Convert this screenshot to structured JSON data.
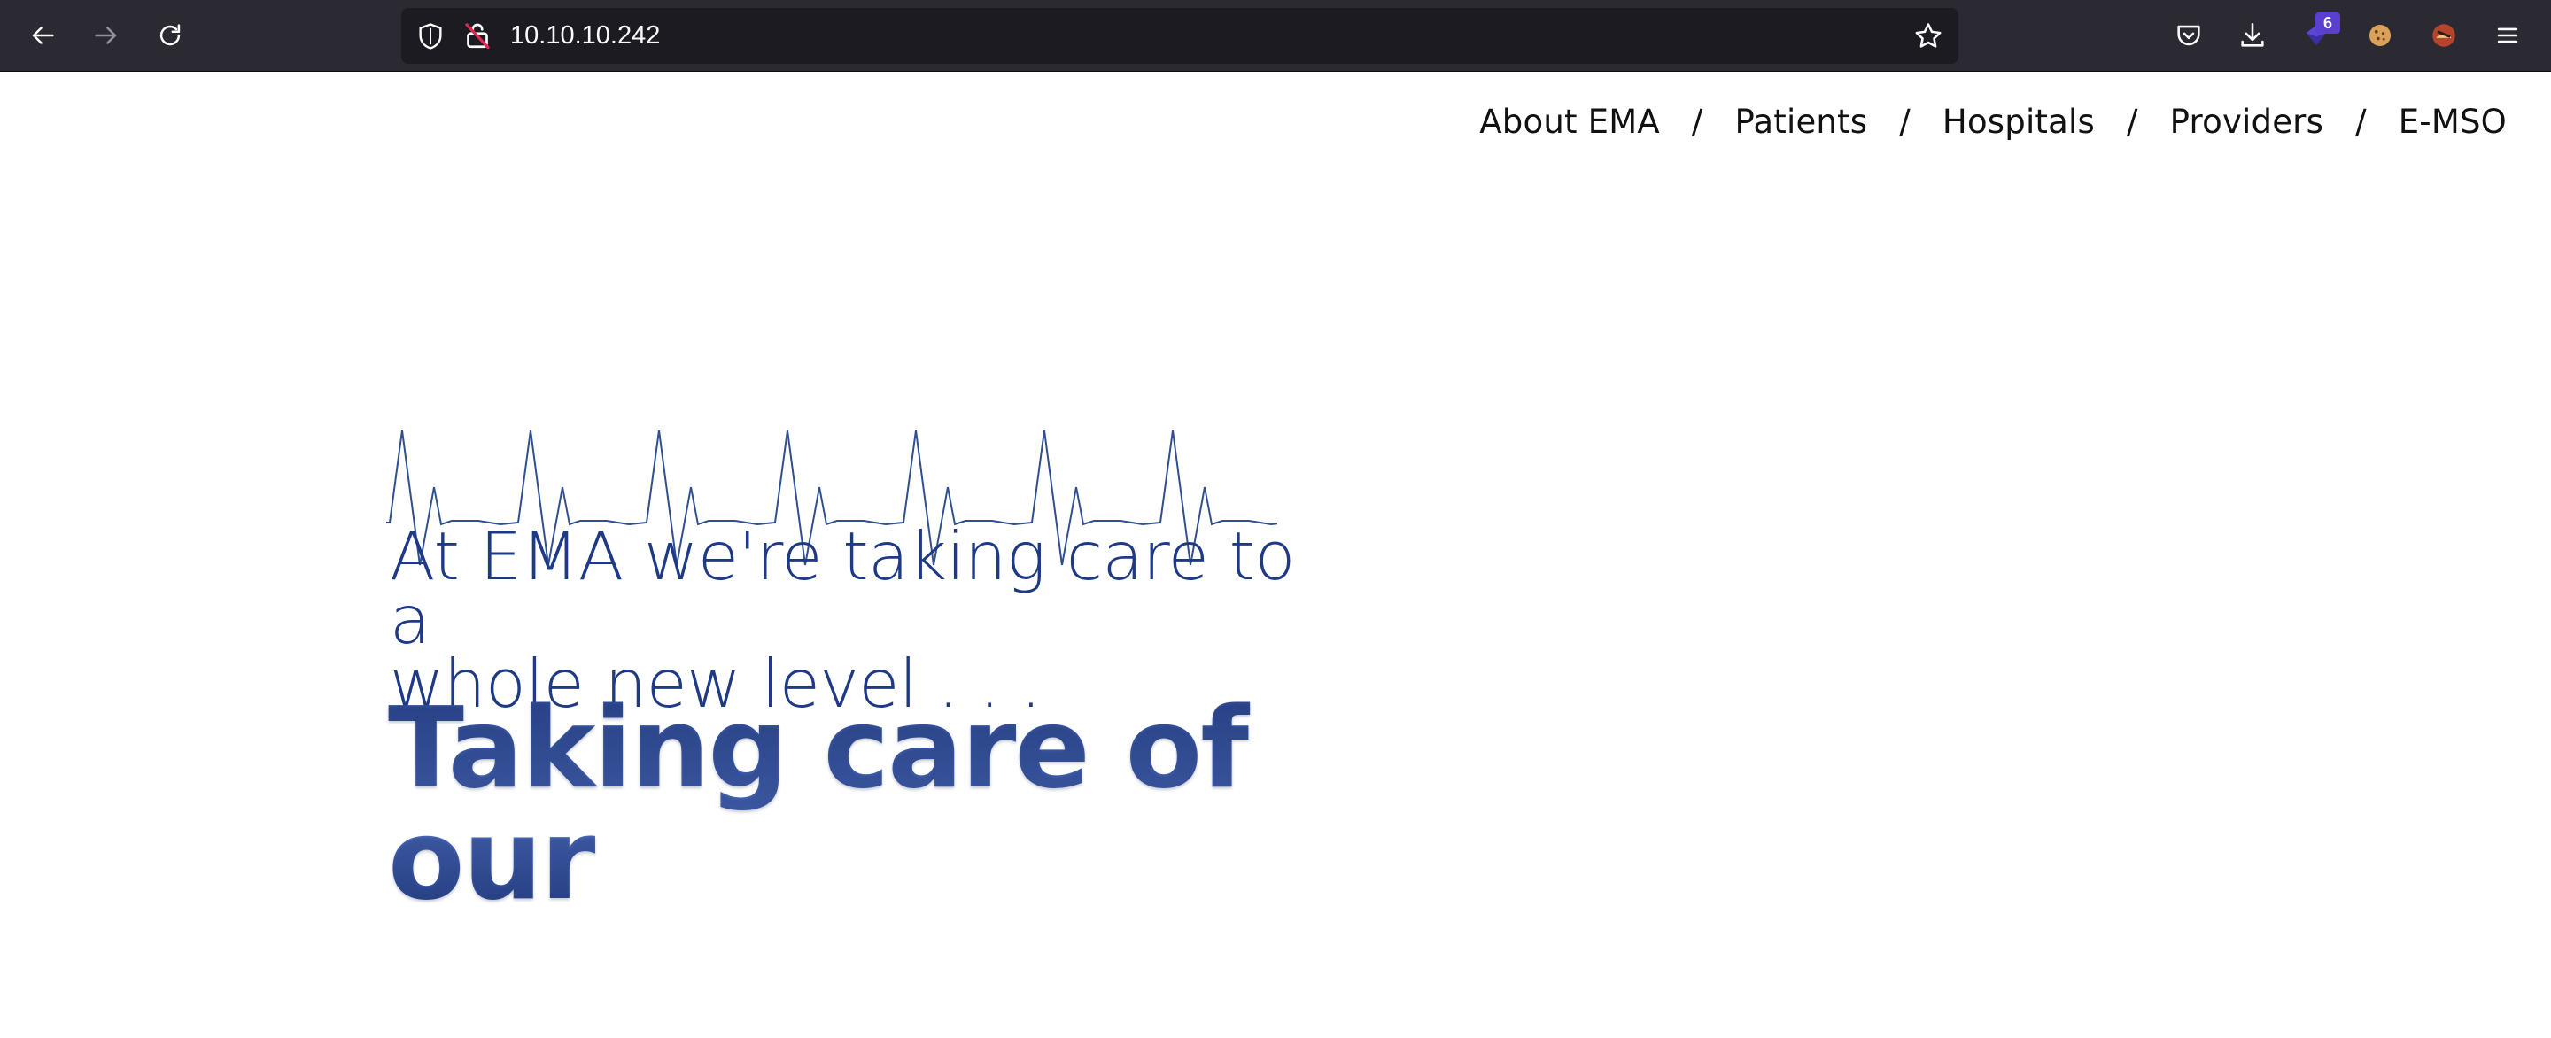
{
  "browser": {
    "url": "10.10.10.242",
    "extension_badge": "6"
  },
  "site": {
    "nav": [
      {
        "label": "About EMA"
      },
      {
        "label": "Patients"
      },
      {
        "label": "Hospitals"
      },
      {
        "label": "Providers"
      },
      {
        "label": "E-MSO"
      }
    ],
    "nav_separator": "/",
    "tagline_line1": "At EMA we're taking care to a",
    "tagline_line2": "whole new level . . .",
    "headline_line1": "Taking care of",
    "headline_line2": "our"
  },
  "colors": {
    "chrome_bg": "#2b2a33",
    "urlbar_bg": "#1c1b22",
    "brand_blue": "#1e3a86",
    "ekg_line": "#2f4f8f"
  }
}
